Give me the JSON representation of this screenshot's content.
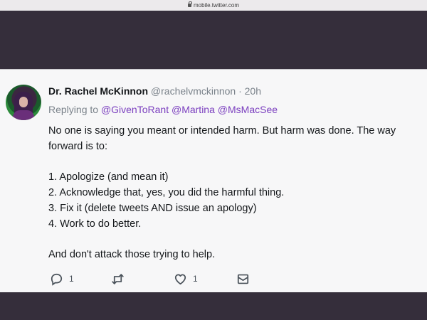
{
  "browser": {
    "url": "mobile.twitter.com"
  },
  "tweet": {
    "author_name": "Dr. Rachel McKinnon",
    "handle": "@rachelvmckinnon",
    "separator": "·",
    "time": "20h",
    "replying_prefix": "Replying to",
    "mentions": [
      "@GivenToRant",
      "@Martina",
      "@MsMacSee"
    ],
    "lines": [
      "No one is saying you meant or intended harm. But harm was done. The way forward is to:",
      "1. Apologize (and mean it)",
      "2. Acknowledge that, yes, you did the harmful thing.",
      "3. Fix it (delete tweets AND issue an apology)",
      "4. Work to do better.",
      "And don't attack those trying to help."
    ],
    "actions": {
      "reply_icon": "reply-icon",
      "reply_count": "1",
      "retweet_icon": "retweet-icon",
      "like_icon": "heart-icon",
      "like_count": "1",
      "dm_icon": "envelope-icon"
    }
  }
}
